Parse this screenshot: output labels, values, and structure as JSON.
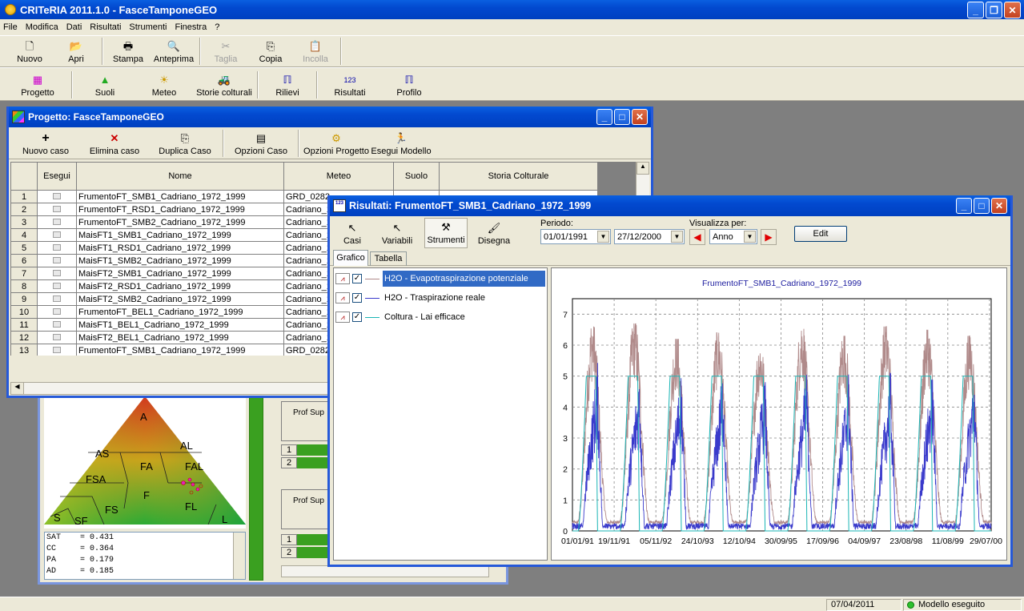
{
  "app": {
    "title": "CRITeRIA 2011.1.0 - FasceTamponeGEO"
  },
  "menu": [
    "File",
    "Modifica",
    "Dati",
    "Risultati",
    "Strumenti",
    "Finestra",
    "?"
  ],
  "toolbar1": {
    "nuovo": "Nuovo",
    "apri": "Apri",
    "stampa": "Stampa",
    "anteprima": "Anteprima",
    "taglia": "Taglia",
    "copia": "Copia",
    "incolla": "Incolla"
  },
  "toolbar2": {
    "progetto": "Progetto",
    "suoli": "Suoli",
    "meteo": "Meteo",
    "storie": "Storie colturali",
    "rilievi": "Rilievi",
    "risultati": "Risultati",
    "profilo": "Profilo"
  },
  "project": {
    "title": "Progetto: FasceTamponeGEO",
    "toolbar": {
      "nuovo": "Nuovo caso",
      "elimina": "Elimina caso",
      "duplica": "Duplica Caso",
      "opzioni_caso": "Opzioni Caso",
      "opzioni_progetto": "Opzioni Progetto",
      "esegui": "Esegui Modello"
    },
    "columns": {
      "esegui": "Esegui",
      "nome": "Nome",
      "meteo": "Meteo",
      "suolo": "Suolo",
      "storia": "Storia Colturale"
    },
    "rows": [
      {
        "n": "1",
        "nome": "FrumentoFT_SMB1_Cadriano_1972_1999",
        "meteo": "GRD_0282"
      },
      {
        "n": "2",
        "nome": "FrumentoFT_RSD1_Cadriano_1972_1999",
        "meteo": "Cadriano_1"
      },
      {
        "n": "3",
        "nome": "FrumentoFT_SMB2_Cadriano_1972_1999",
        "meteo": "Cadriano_1"
      },
      {
        "n": "4",
        "nome": "MaisFT1_SMB1_Cadriano_1972_1999",
        "meteo": "Cadriano_1"
      },
      {
        "n": "5",
        "nome": "MaisFT1_RSD1_Cadriano_1972_1999",
        "meteo": "Cadriano_1"
      },
      {
        "n": "6",
        "nome": "MaisFT1_SMB2_Cadriano_1972_1999",
        "meteo": "Cadriano_1"
      },
      {
        "n": "7",
        "nome": "MaisFT2_SMB1_Cadriano_1972_1999",
        "meteo": "Cadriano_1"
      },
      {
        "n": "8",
        "nome": "MaisFT2_RSD1_Cadriano_1972_1999",
        "meteo": "Cadriano_1"
      },
      {
        "n": "9",
        "nome": "MaisFT2_SMB2_Cadriano_1972_1999",
        "meteo": "Cadriano_1"
      },
      {
        "n": "10",
        "nome": "FrumentoFT_BEL1_Cadriano_1972_1999",
        "meteo": "Cadriano_1"
      },
      {
        "n": "11",
        "nome": "MaisFT1_BEL1_Cadriano_1972_1999",
        "meteo": "Cadriano_1"
      },
      {
        "n": "12",
        "nome": "MaisFT2_BEL1_Cadriano_1972_1999",
        "meteo": "Cadriano_1"
      },
      {
        "n": "13",
        "nome": "FrumentoFT_SMB1_Cadriano_1972_1999",
        "meteo": "GRD_0282"
      }
    ]
  },
  "soil": {
    "triangle_labels": [
      "A",
      "AS",
      "AL",
      "FA",
      "FAL",
      "FSA",
      "F",
      "FS",
      "FL",
      "S",
      "SF",
      "L"
    ],
    "params": [
      "SAT    = 0.431",
      "CC     = 0.364",
      "PA     = 0.179",
      "AD     = 0.185"
    ],
    "rows": [
      "1",
      "2",
      "1",
      "2"
    ],
    "prof_label": "Prof Sup"
  },
  "results": {
    "title": "Risultati: FrumentoFT_SMB1_Cadriano_1972_1999",
    "toolbar": {
      "casi": "Casi",
      "variabili": "Variabili",
      "strumenti": "Strumenti",
      "disegna": "Disegna"
    },
    "periodo_label": "Periodo:",
    "date_from": "01/01/1991",
    "date_to": "27/12/2000",
    "visualizza_label": "Visualizza per:",
    "visualizza_value": "Anno",
    "edit_label": "Edit",
    "tabs": [
      "Grafico",
      "Tabella"
    ],
    "variables": [
      {
        "label": "H2O - Evapotraspirazione potenziale",
        "color": "#b08a8a",
        "checked": true,
        "selected": true
      },
      {
        "label": "H2O - Traspirazione reale",
        "color": "#3a3acb",
        "checked": true,
        "selected": false
      },
      {
        "label": "Coltura - Lai efficace",
        "color": "#1ab5b5",
        "checked": true,
        "selected": false
      }
    ]
  },
  "chart_data": {
    "type": "line",
    "title": "FrumentoFT_SMB1_Cadriano_1972_1999",
    "xlabel": "",
    "ylabel": "",
    "ylim": [
      0,
      7.5
    ],
    "yticks": [
      0,
      1,
      2,
      3,
      4,
      5,
      6,
      7
    ],
    "xticks": [
      "01/01/91",
      "19/11/91",
      "05/11/92",
      "24/10/93",
      "12/10/94",
      "30/09/95",
      "17/09/96",
      "04/09/97",
      "23/08/98",
      "11/08/99",
      "29/07/00"
    ],
    "x_range": [
      "01/01/1991",
      "27/12/2000"
    ],
    "grid": true,
    "series": [
      {
        "name": "H2O - Evapotraspirazione potenziale",
        "color": "#b08a8a",
        "annual_peak": [
          6.4,
          6.5,
          6.0,
          6.2,
          5.8,
          6.4,
          6.1,
          6.4,
          6.3,
          6.1
        ]
      },
      {
        "name": "H2O - Traspirazione reale",
        "color": "#3a3acb",
        "annual_peak": [
          5.2,
          5.0,
          5.0,
          5.1,
          4.9,
          5.0,
          5.0,
          5.0,
          5.0,
          5.0
        ]
      },
      {
        "name": "Coltura - Lai efficace",
        "color": "#1ab5b5",
        "annual_peak": [
          5,
          5,
          5,
          5,
          5,
          5,
          5,
          5,
          5,
          5
        ]
      }
    ]
  },
  "status": {
    "date": "07/04/2011",
    "model": "Modello eseguito"
  }
}
